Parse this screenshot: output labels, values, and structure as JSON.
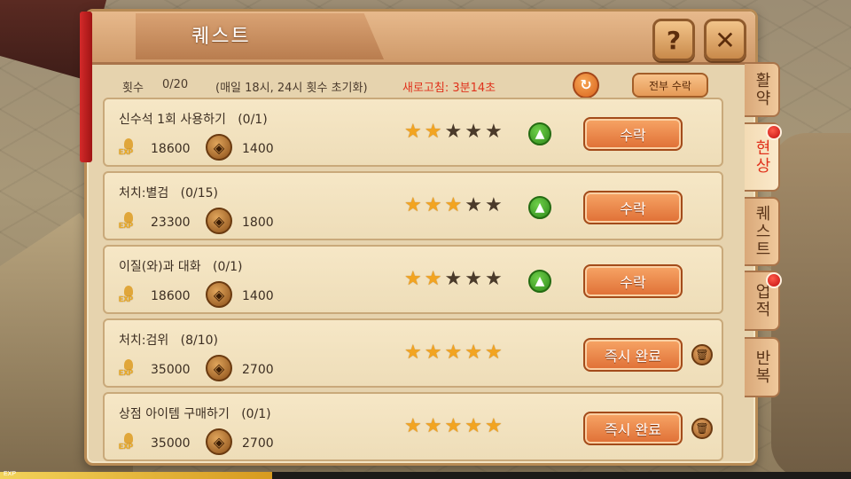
{
  "panel": {
    "title": "퀘스트",
    "help_icon": "question-mark-icon",
    "close_icon": "close-x-icon"
  },
  "info": {
    "count_label": "횟수",
    "count_value": "0/20",
    "reset_note": "(매일 18시, 24시 횟수 초기화)",
    "refresh_timer": "새로고침: 3분14초",
    "claim_all_label": "전부 수락"
  },
  "quests": [
    {
      "title": "신수석 1회 사용하기",
      "progress": "(0/1)",
      "exp": "18600",
      "gold": "1400",
      "stars": 2,
      "button": "수락",
      "upgrade": true
    },
    {
      "title": "처치:별검",
      "progress": "(0/15)",
      "exp": "23300",
      "gold": "1800",
      "stars": 3,
      "button": "수락",
      "upgrade": true
    },
    {
      "title": "이질(와)과 대화",
      "progress": "(0/1)",
      "exp": "18600",
      "gold": "1400",
      "stars": 2,
      "button": "수락",
      "upgrade": true
    },
    {
      "title": "처치:검위",
      "progress": "(8/10)",
      "exp": "35000",
      "gold": "2700",
      "stars": 5,
      "button": "즉시 완료",
      "upgrade": false
    },
    {
      "title": "상점 아이템 구매하기",
      "progress": "(0/1)",
      "exp": "35000",
      "gold": "2700",
      "stars": 5,
      "button": "즉시 완료",
      "upgrade": false
    }
  ],
  "tabs": [
    {
      "label": "활약",
      "active": false,
      "badge": false
    },
    {
      "label": "현상",
      "active": true,
      "badge": true
    },
    {
      "label": "퀘스트",
      "active": false,
      "badge": false
    },
    {
      "label": "업적",
      "active": false,
      "badge": true
    },
    {
      "label": "반복",
      "active": false,
      "badge": false
    }
  ],
  "exp_bar": {
    "label": "EXP",
    "progress": 0.32
  },
  "colors": {
    "accent_red": "#e0321c",
    "star_on": "#f2a421",
    "button_orange": "#df6f35"
  }
}
